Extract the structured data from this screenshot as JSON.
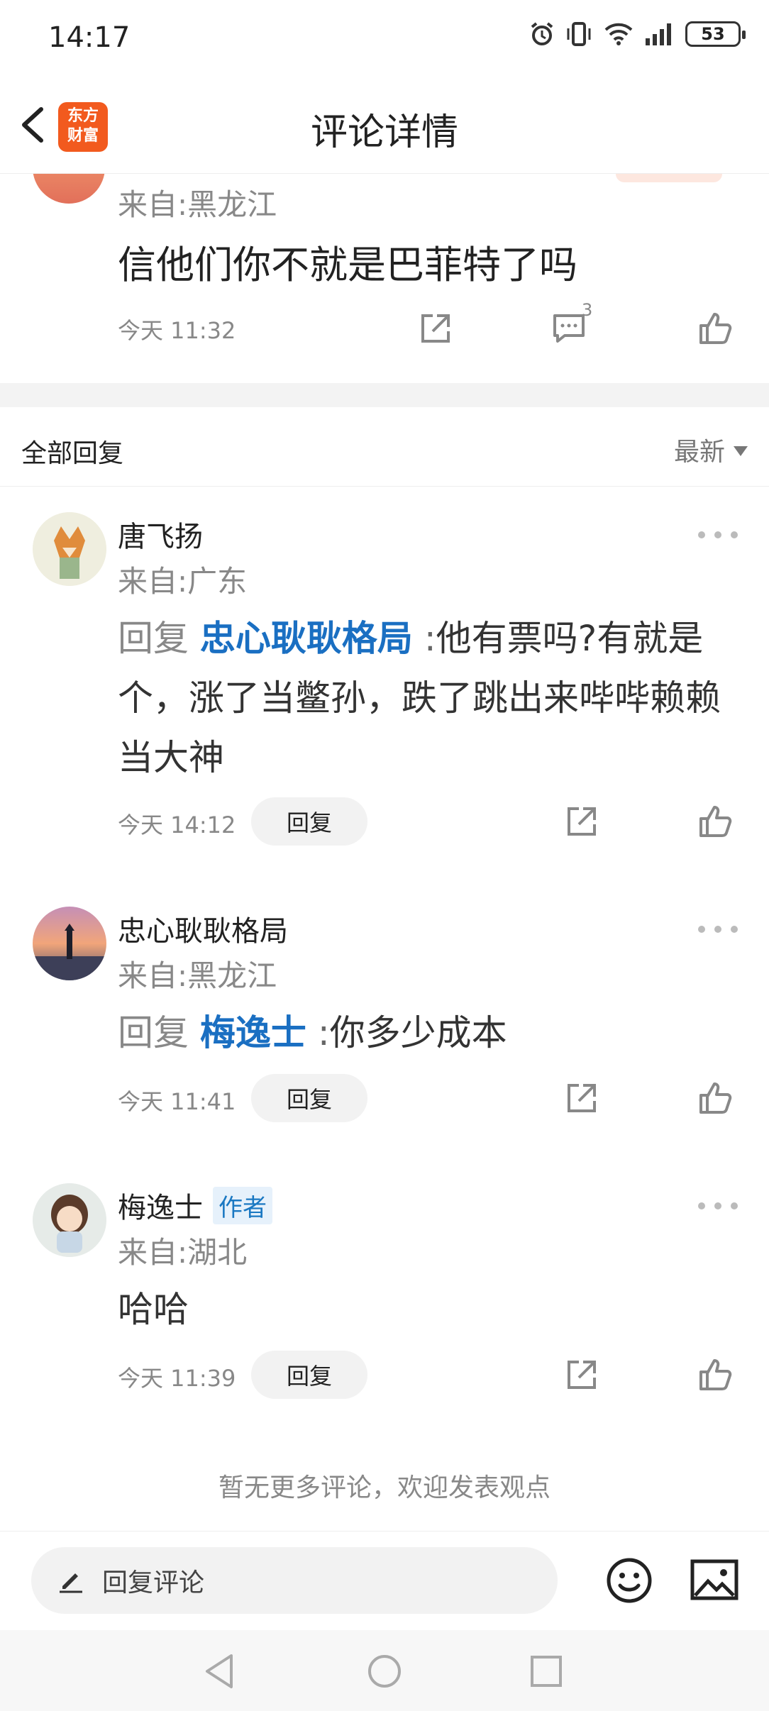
{
  "status_bar": {
    "time": "14:17",
    "battery": "53"
  },
  "nav": {
    "title": "评论详情",
    "logo_text": "东方\n财富"
  },
  "main_comment": {
    "from": "来自:黑龙江",
    "text": "信他们你不就是巴菲特了吗",
    "time": "今天 11:32",
    "comment_count": "3"
  },
  "section": {
    "title": "全部回复",
    "sort_label": "最新"
  },
  "replies": [
    {
      "name": "唐飞扬",
      "from": "来自:广东",
      "prefix": "回复",
      "mention": "忠心耿耿格局",
      "colon": ":",
      "text": "他有票吗?有就是个，涨了当鳖孙，跌了跳出来哔哔赖赖当大神",
      "time": "今天 14:12",
      "reply_label": "回复"
    },
    {
      "name": "忠心耿耿格局",
      "from": "来自:黑龙江",
      "prefix": "回复",
      "mention": "梅逸士",
      "colon": ":",
      "text": "你多少成本",
      "time": "今天 11:41",
      "reply_label": "回复"
    },
    {
      "name": "梅逸士",
      "author_tag": "作者",
      "from": "来自:湖北",
      "text": "哈哈",
      "time": "今天 11:39",
      "reply_label": "回复"
    }
  ],
  "footer_note": "暂无更多评论，欢迎发表观点",
  "input": {
    "placeholder": "回复评论"
  },
  "colors": {
    "accent": "#1a6fc2",
    "brand": "#f25a1e",
    "muted": "#888888"
  }
}
